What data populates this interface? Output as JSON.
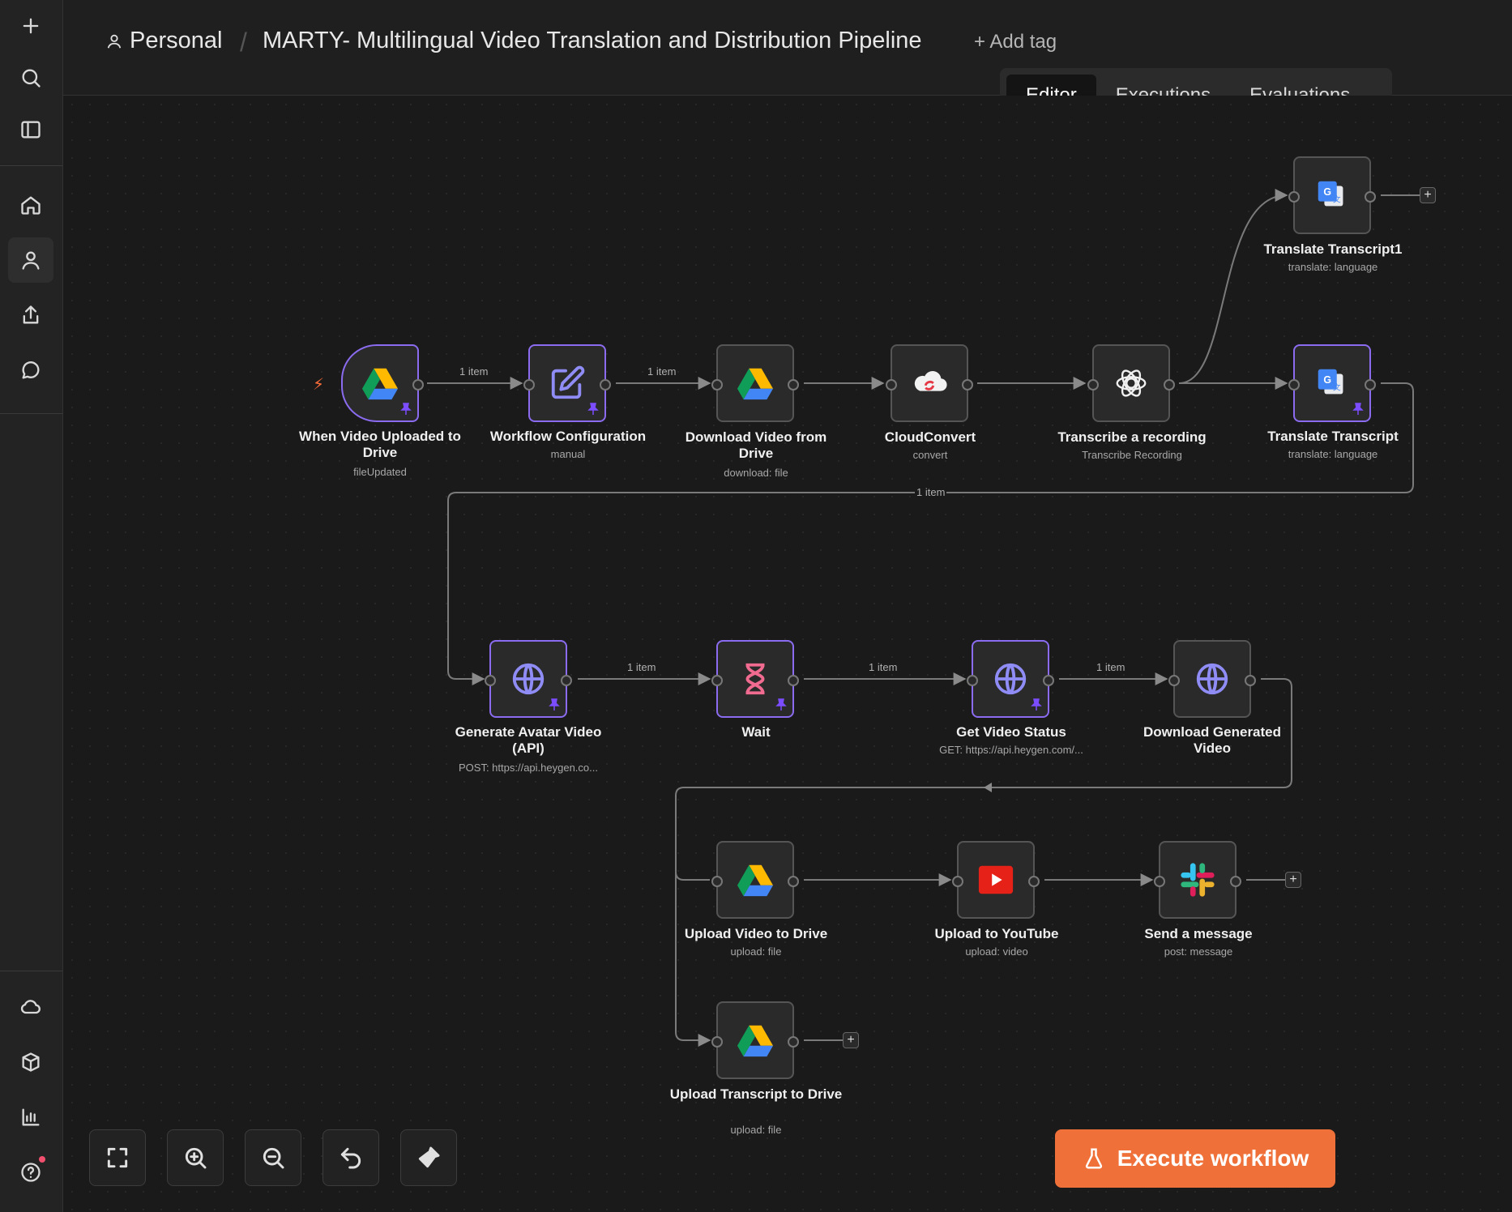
{
  "header": {
    "project": "Personal",
    "title": "MARTY- Multilingual Video Translation and Distribution Pipeline",
    "add_tag": "+ Add tag",
    "tabs": [
      "Editor",
      "Executions",
      "Evaluations"
    ],
    "active_tab": "Editor"
  },
  "sidebar": {
    "top": [
      "plus-icon",
      "search-icon",
      "panel-icon"
    ],
    "nav": [
      "home-icon",
      "user-icon",
      "share-icon",
      "chat-icon"
    ],
    "bottom": [
      "cloud-icon",
      "templates-icon",
      "insights-icon",
      "help-icon"
    ]
  },
  "nodes": {
    "n1": {
      "label": "When Video Uploaded to Drive",
      "sub": "fileUpdated",
      "icon": "google-drive-icon"
    },
    "n2": {
      "label": "Workflow Configuration",
      "sub": "manual",
      "icon": "edit-icon"
    },
    "n3": {
      "label": "Download Video from Drive",
      "sub": "download: file",
      "icon": "google-drive-icon"
    },
    "n4": {
      "label": "CloudConvert",
      "sub": "convert",
      "icon": "cloudconvert-icon"
    },
    "n5": {
      "label": "Transcribe a recording",
      "sub": "Transcribe Recording",
      "icon": "openai-icon"
    },
    "n6": {
      "label": "Translate Transcript1",
      "sub": "translate: language",
      "icon": "google-translate-icon"
    },
    "n7": {
      "label": "Translate Transcript",
      "sub": "translate: language",
      "icon": "google-translate-icon"
    },
    "n8": {
      "label": "Generate Avatar Video (API)",
      "sub": "POST: https://api.heygen.co...",
      "icon": "globe-icon"
    },
    "n9": {
      "label": "Wait",
      "sub": "",
      "icon": "hourglass-icon"
    },
    "n10": {
      "label": "Get Video Status",
      "sub": "GET: https://api.heygen.com/...",
      "icon": "globe-icon"
    },
    "n11": {
      "label": "Download Generated Video",
      "sub": "",
      "icon": "globe-icon"
    },
    "n12": {
      "label": "Upload Video to Drive",
      "sub": "upload: file",
      "icon": "google-drive-icon"
    },
    "n13": {
      "label": "Upload to YouTube",
      "sub": "upload: video",
      "icon": "youtube-icon"
    },
    "n14": {
      "label": "Send a message",
      "sub": "post: message",
      "icon": "slack-icon"
    },
    "n15": {
      "label": "Upload Transcript to Drive",
      "sub": "upload: file",
      "icon": "google-drive-icon"
    }
  },
  "edge_labels": {
    "item": "1 item"
  },
  "controls": [
    "fit-view-icon",
    "zoom-in-icon",
    "zoom-out-icon",
    "undo-icon",
    "tidy-up-icon"
  ],
  "execute_button": "Execute workflow",
  "colors": {
    "accent": "#ef7139",
    "selected": "#8b6cf0",
    "pin": "#7c4dff"
  }
}
